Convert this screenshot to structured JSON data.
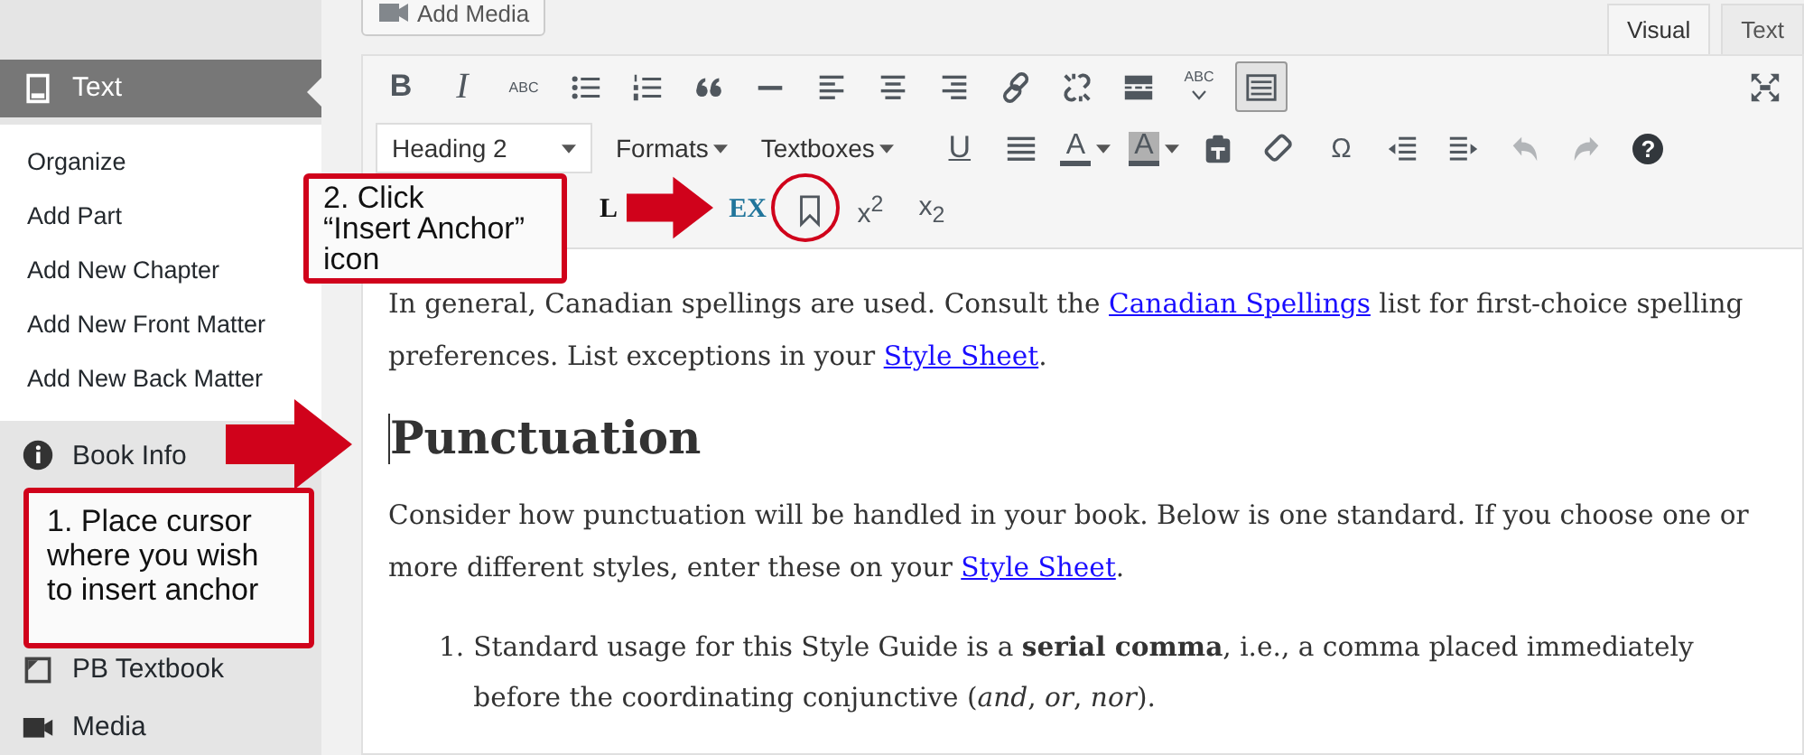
{
  "sidebar": {
    "items": [
      {
        "label": "Text",
        "selected": true,
        "submenu": [
          "Organize",
          "Add Part",
          "Add New Chapter",
          "Add New Front Matter",
          "Add New Back Matter"
        ]
      },
      {
        "label": "Book Info",
        "selected": false
      },
      {
        "label": "PB Textbook",
        "selected": false
      },
      {
        "label": "Media",
        "selected": false
      }
    ]
  },
  "editor": {
    "add_media": "Add Media",
    "tabs": [
      {
        "label": "Visual",
        "selected": true
      },
      {
        "label": "Text",
        "selected": false
      }
    ],
    "toolbar": [
      [
        {
          "kind": "bold",
          "label": "B",
          "pressed": false
        },
        {
          "kind": "italic",
          "label": "I",
          "pressed": false
        },
        {
          "kind": "strike",
          "label": "ABC",
          "pressed": false
        },
        {
          "kind": "bullets",
          "pressed": false
        },
        {
          "kind": "numbers",
          "pressed": false
        },
        {
          "kind": "quote",
          "pressed": false
        },
        {
          "kind": "hr",
          "pressed": false
        },
        {
          "kind": "align-left",
          "pressed": false
        },
        {
          "kind": "align-center",
          "pressed": false
        },
        {
          "kind": "align-right",
          "pressed": false
        },
        {
          "kind": "link",
          "pressed": false
        },
        {
          "kind": "unlink",
          "pressed": false
        },
        {
          "kind": "more",
          "pressed": false
        },
        {
          "kind": "spellcheck",
          "label": "ABC",
          "pressed": false
        },
        {
          "kind": "toggle",
          "pressed": true
        },
        {
          "kind": "fullscreen",
          "pressed": false
        }
      ],
      [
        {
          "kind": "select",
          "label": "Heading 2",
          "disabled": false
        },
        {
          "kind": "menu",
          "label": "Formats",
          "disabled": false
        },
        {
          "kind": "menu",
          "label": "Textboxes",
          "disabled": false
        },
        {
          "kind": "underline",
          "label": "U",
          "disabled": false
        },
        {
          "kind": "justify",
          "disabled": false
        },
        {
          "kind": "text-color",
          "label": "A",
          "disabled": false
        },
        {
          "kind": "bg-color",
          "label": "A",
          "disabled": false
        },
        {
          "kind": "paste-text",
          "disabled": false
        },
        {
          "kind": "eraser",
          "disabled": false
        },
        {
          "kind": "char",
          "label": "Ω",
          "disabled": false
        },
        {
          "kind": "outdent",
          "disabled": false
        },
        {
          "kind": "indent",
          "disabled": false
        },
        {
          "kind": "undo",
          "disabled": true
        },
        {
          "kind": "redo",
          "disabled": true
        },
        {
          "kind": "help",
          "label": "?",
          "disabled": false
        }
      ],
      [
        {
          "kind": "serif",
          "label": "L"
        },
        {
          "kind": "blue-serif",
          "label": "EX"
        },
        {
          "kind": "anchor"
        },
        {
          "kind": "char",
          "label": "x$^{2}$"
        },
        {
          "kind": "char",
          "label": "x$_{2}$"
        }
      ]
    ],
    "content": [
      {
        "kind": "paragraph",
        "parts": [
          {
            "kind": "text",
            "text": "In general, Canadian spellings are used. Consult the "
          },
          {
            "kind": "link",
            "text": "Canadian Spellings"
          },
          {
            "kind": "text",
            "text": " list for first-choice spelling preferences. List exceptions in your "
          },
          {
            "kind": "link",
            "text": "Style Sheet"
          },
          {
            "kind": "text",
            "text": "."
          }
        ]
      },
      {
        "kind": "heading",
        "text": "Punctuation"
      },
      {
        "kind": "paragraph",
        "parts": [
          {
            "kind": "text",
            "text": "Consider how punctuation will be handled in your book. Below is one standard. If you choose one or more different styles, enter these on your "
          },
          {
            "kind": "link",
            "text": "Style Sheet"
          },
          {
            "kind": "text",
            "text": "."
          }
        ]
      },
      {
        "kind": "list",
        "items": [
          {
            "number": "1.",
            "text": "Standard usage for this Style Guide is a **serial comma**, i.e., a comma placed immediately before the coordinating conjunctive (*and*, *or*, *nor*)."
          }
        ]
      }
    ]
  },
  "callouts": [
    {
      "lines": [
        "2. Click",
        "“Insert Anchor”",
        "icon"
      ]
    },
    {
      "lines": [
        "1. Place cursor",
        "where you wish",
        "to insert anchor"
      ]
    }
  ]
}
